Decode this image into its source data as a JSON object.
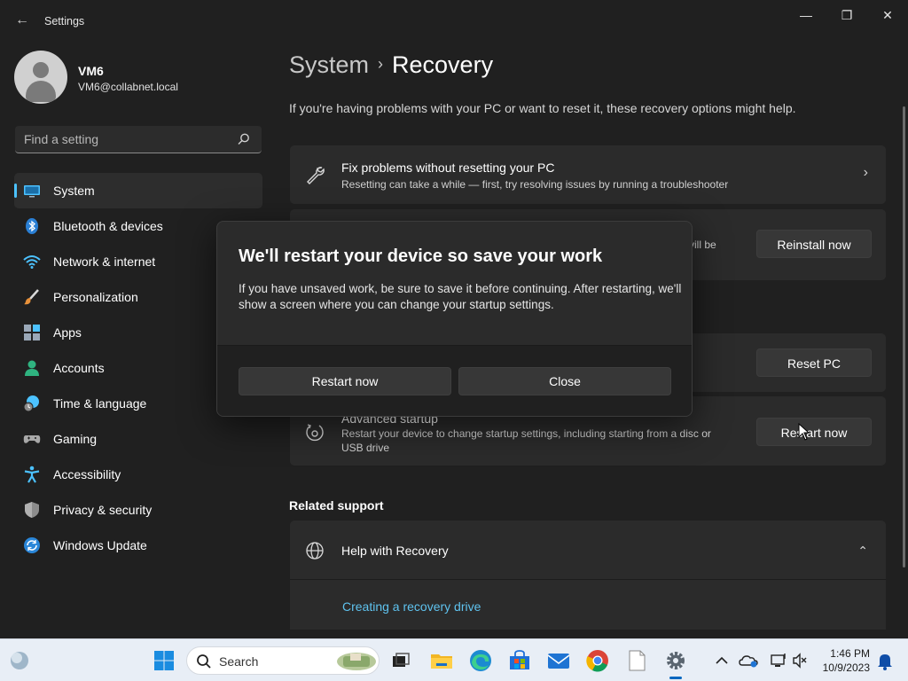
{
  "window": {
    "app_title": "Settings",
    "back_glyph": "←",
    "minimize_glyph": "—",
    "maximize_glyph": "❐",
    "close_glyph": "✕"
  },
  "user": {
    "name": "VM6",
    "email": "VM6@collabnet.local"
  },
  "search": {
    "placeholder": "Find a setting"
  },
  "sidebar": {
    "items": [
      {
        "label": "System",
        "icon": "system-icon"
      },
      {
        "label": "Bluetooth & devices",
        "icon": "bluetooth-icon"
      },
      {
        "label": "Network & internet",
        "icon": "wifi-icon"
      },
      {
        "label": "Personalization",
        "icon": "brush-icon"
      },
      {
        "label": "Apps",
        "icon": "apps-icon"
      },
      {
        "label": "Accounts",
        "icon": "person-icon"
      },
      {
        "label": "Time & language",
        "icon": "globe-clock-icon"
      },
      {
        "label": "Gaming",
        "icon": "gamepad-icon"
      },
      {
        "label": "Accessibility",
        "icon": "accessibility-icon"
      },
      {
        "label": "Privacy & security",
        "icon": "shield-icon"
      },
      {
        "label": "Windows Update",
        "icon": "update-icon"
      }
    ]
  },
  "main": {
    "breadcrumb_parent": "System",
    "breadcrumb_sep": "›",
    "breadcrumb_current": "Recovery",
    "intro": "If you're having problems with your PC or want to reset it, these recovery options might help.",
    "fix_card": {
      "title": "Fix problems without resetting your PC",
      "desc": "Resetting can take a while — first, try resolving issues by running a troubleshooter",
      "chevron": "›"
    },
    "reinstall_card": {
      "partial_desc": "vill be",
      "button": "Reinstall now"
    },
    "reset_card": {
      "button": "Reset PC"
    },
    "advanced_card": {
      "title": "Advanced startup",
      "desc": "Restart your device to change startup settings, including starting from a disc or USB drive",
      "button": "Restart now"
    },
    "related_support": "Related support",
    "help_card": {
      "title": "Help with Recovery",
      "chevron": "⌃"
    },
    "help_link": "Creating a recovery drive"
  },
  "dialog": {
    "title": "We'll restart your device so save your work",
    "text": "If you have unsaved work, be sure to save it before continuing. After restarting, we'll show a screen where you can change your startup settings.",
    "primary_button": "Restart now",
    "secondary_button": "Close"
  },
  "taskbar": {
    "search_label": "Search",
    "time": "1:46 PM",
    "date": "10/9/2023"
  }
}
